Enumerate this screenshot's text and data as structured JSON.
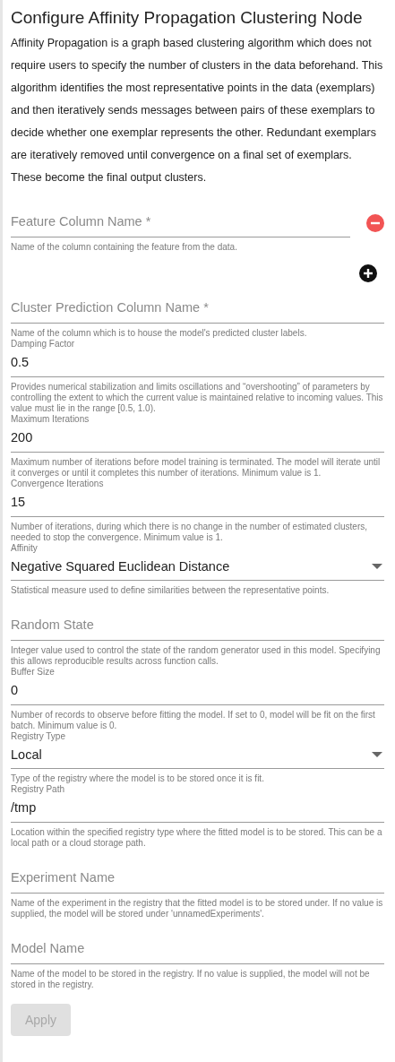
{
  "title": "Configure Affinity Propagation Clustering Node",
  "description": "Affinity Propagation is a graph based clustering algorithm which does not require users to specify the number of clusters in the data beforehand. This algorithm identifies the most representative points in the data (exemplars) and then iteratively sends messages between pairs of these exemplars to decide whether one exemplar represents the other. Redundant exemplars are iteratively removed until convergence on a final set of exemplars. These become the final output clusters.",
  "feature_column": {
    "placeholder": "Feature Column Name *",
    "help": "Name of the column containing the feature from the data."
  },
  "fields": [
    {
      "kind": "text",
      "placeholder": "Cluster Prediction Column Name *",
      "help": "Name of the column which is to house the model's predicted cluster labels."
    },
    {
      "kind": "value",
      "label": "Damping Factor",
      "value": "0.5",
      "help": "Provides numerical stabilization and limits oscillations and “overshooting” of parameters by controlling the extent to which the current value is maintained relative to incoming values. This value must lie in the range [0.5, 1.0)."
    },
    {
      "kind": "value",
      "label": "Maximum Iterations",
      "value": "200",
      "help": "Maximum number of iterations before model training is terminated. The model will iterate until it converges or until it completes this number of iterations. Minimum value is 1."
    },
    {
      "kind": "value",
      "label": "Convergence Iterations",
      "value": "15",
      "help": "Number of iterations, during which there is no change in the number of estimated clusters, needed to stop the convergence. Minimum value is 1."
    },
    {
      "kind": "select",
      "label": "Affinity",
      "value": "Negative Squared Euclidean Distance",
      "help": "Statistical measure used to define similarities between the representative points."
    },
    {
      "kind": "text",
      "placeholder": "Random State",
      "help": "Integer value used to control the state of the random generator used in this model. Specifying this allows reproducible results across function calls."
    },
    {
      "kind": "value",
      "label": "Buffer Size",
      "value": "0",
      "help": "Number of records to observe before fitting the model. If set to 0, model will be fit on the first batch. Minimum value is 0."
    },
    {
      "kind": "select",
      "label": "Registry Type",
      "value": "Local",
      "help": "Type of the registry where the model is to be stored once it is fit."
    },
    {
      "kind": "value",
      "label": "Registry Path",
      "value": "/tmp",
      "help": "Location within the specified registry type where the fitted model is to be stored. This can be a local path or a cloud storage path."
    },
    {
      "kind": "text",
      "placeholder": "Experiment Name",
      "help": "Name of the experiment in the registry that the fitted model is to be stored under. If no value is supplied, the model will be stored under 'unnamedExperiments'."
    },
    {
      "kind": "text",
      "placeholder": "Model Name",
      "help": "Name of the model to be stored in the registry. If no value is supplied, the model will not be stored in the registry."
    }
  ],
  "apply_button": {
    "label": "Apply",
    "disabled": true
  }
}
